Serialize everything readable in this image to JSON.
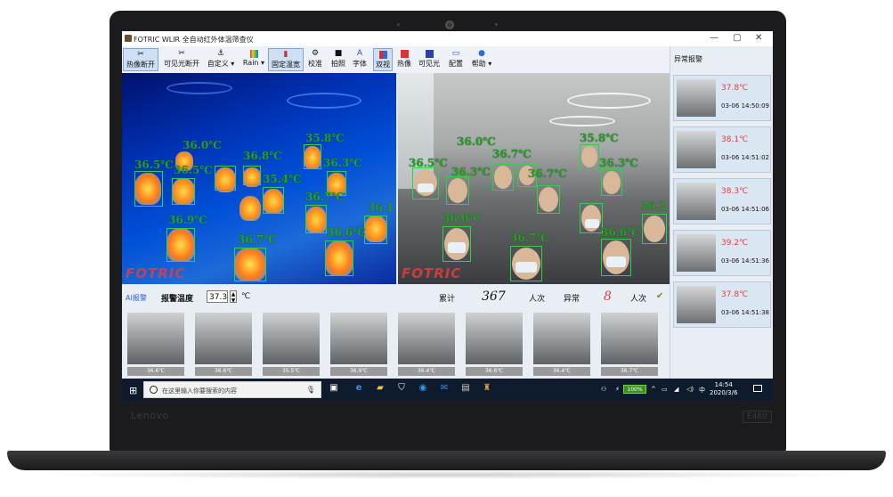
{
  "window": {
    "title": "FOTRIC WLIR 全自动红外体温筛查仪",
    "minimize": "—",
    "maximize": "▢",
    "close": "✕"
  },
  "toolbar": {
    "items": [
      {
        "label": "热像断开",
        "icon": "disconnect-icon"
      },
      {
        "label": "可见光断开",
        "icon": "disconnect-icon"
      },
      {
        "label": "自定义",
        "icon": "anchor-icon"
      },
      {
        "label": "Rain",
        "icon": "palette-icon"
      },
      {
        "label": "固定温宽",
        "icon": "range-icon"
      },
      {
        "label": "校准",
        "icon": "gear-icon"
      },
      {
        "label": "拍照",
        "icon": "camera-icon"
      },
      {
        "label": "字体",
        "icon": "font-icon"
      },
      {
        "label": "双视",
        "icon": "dual-view-icon"
      },
      {
        "label": "热像",
        "icon": "thermal-icon"
      },
      {
        "label": "可见光",
        "icon": "visible-icon"
      },
      {
        "label": "配置",
        "icon": "monitor-icon"
      },
      {
        "label": "帮助",
        "icon": "info-icon"
      }
    ]
  },
  "alarm_panel": {
    "title": "异常报警",
    "entries": [
      {
        "temp": "37.8℃",
        "time": "03-06 14:50:09"
      },
      {
        "temp": "38.1℃",
        "time": "03-06 14:51:02"
      },
      {
        "temp": "38.3℃",
        "time": "03-06 14:51:06"
      },
      {
        "temp": "39.2℃",
        "time": "03-06 14:51:36"
      },
      {
        "temp": "37.8℃",
        "time": "03-06 14:51:38"
      }
    ]
  },
  "thermal_view": {
    "watermark": "FOTRIC",
    "labels": [
      "36.0℃",
      "35.8℃",
      "36.5℃",
      "36.5℃",
      "36.8℃",
      "36.3℃",
      "35.4℃",
      "36.9℃",
      "36.7℃",
      "36.7℃",
      "36.6℃",
      "36.1"
    ]
  },
  "visible_view": {
    "watermark": "FOTRIC",
    "labels": [
      "36.0℃",
      "35.8℃",
      "36.5℃",
      "36.7℃",
      "36.3℃",
      "36.7℃",
      "36.3℃",
      "36.0℃",
      "36.7℃",
      "36.6℃",
      "36.2"
    ]
  },
  "status": {
    "ai_alarm": "AI报警",
    "warn_label": "报警温度",
    "warn_value": "37.3",
    "unit": "℃",
    "cumulative_label": "累计",
    "cumulative_value": "367",
    "person_unit_1": "人次",
    "abnormal_label": "异常",
    "abnormal_value": "8",
    "person_unit_2": "人次"
  },
  "gallery": {
    "items": [
      {
        "temp": "36.6℃"
      },
      {
        "temp": "36.6℃"
      },
      {
        "temp": "35.5℃"
      },
      {
        "temp": "36.9℃"
      },
      {
        "temp": "36.4℃"
      },
      {
        "temp": "36.6℃"
      },
      {
        "temp": "36.4℃"
      },
      {
        "temp": "36.7℃"
      }
    ]
  },
  "taskbar": {
    "search_placeholder": "在这里输入你要搜索的内容",
    "battery": "100%",
    "ime": "中",
    "time": "14:54",
    "date": "2020/3/6"
  },
  "device": {
    "brand": "Lenovo",
    "model": "E480"
  },
  "colors": {
    "alarm_red": "#e23c3c",
    "box_green": "#31d045",
    "taskbar": "#0e1b2c"
  }
}
